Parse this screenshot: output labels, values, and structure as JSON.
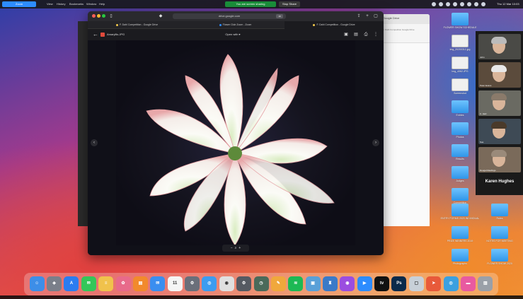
{
  "menubar": {
    "zoom_pill": "Zoom",
    "items": [
      "View",
      "History",
      "Bookmarks",
      "Window",
      "Help"
    ],
    "share_status": "You are screen sharing",
    "stop_share": "Stop Share",
    "clock": "Thu 12 Mar 10:03"
  },
  "browser": {
    "url": "drive.google.com",
    "url_badge": "19",
    "tabs": [
      {
        "label": "F. Dahl Competition - Google Drive",
        "dot_color": "#f2c94c"
      },
      {
        "label": "Flower Club Zoom - Zoom",
        "dot_color": "#2d8cff"
      },
      {
        "label": "F. Dahl Competition - Google Drive",
        "dot_color": "#f2c94c"
      }
    ]
  },
  "viewer": {
    "file_name": "Amaryllis.JPG",
    "open_with": "Open with",
    "zoom_minus": "−",
    "zoom_icon": "⌕",
    "zoom_plus": "+"
  },
  "background_window": {
    "title": "Google Drive",
    "subtitle": "F. Dahl Competition  Google Drive"
  },
  "desktop_icons": [
    {
      "label": "FLOWER SHOW SCHEDULE",
      "kind": "folder"
    },
    {
      "label": "img_20200312.jpg",
      "kind": "doc"
    },
    {
      "label": "img_4062.JPG",
      "kind": "doc"
    },
    {
      "label": "Screenshot",
      "kind": "doc"
    },
    {
      "label": "Entries",
      "kind": "folder"
    },
    {
      "label": "Photos",
      "kind": "folder"
    },
    {
      "label": "Results",
      "kind": "folder"
    },
    {
      "label": "Judges",
      "kind": "folder"
    },
    {
      "label": "Competition",
      "kind": "folder"
    }
  ],
  "desktop_icons_bottom": [
    {
      "label": "ENTRY FORMS 2020 INDIVIDUAL",
      "kind": "folder"
    },
    {
      "label": "Rules",
      "kind": "folder"
    },
    {
      "label": "PRIZE WINNERS 2019",
      "kind": "folder"
    },
    {
      "label": "NOTES FOR MEETING",
      "kind": "folder"
    },
    {
      "label": "Photographs",
      "kind": "folder"
    },
    {
      "label": "FLOWER SHOW 2020",
      "kind": "folder"
    }
  ],
  "zoom_gallery": {
    "tiles": [
      {
        "name": "John",
        "bg": "#4a4a46",
        "hair": "#bbbbbb"
      },
      {
        "name": "Peter Evans",
        "bg": "#5b4b3c",
        "hair": "#e8e8e8"
      },
      {
        "name": "C. Hart",
        "bg": "#6a6a62",
        "hair": "#8a7a6a"
      },
      {
        "name": "Sue",
        "bg": "#3e4a55",
        "hair": "#4a3a2a"
      },
      {
        "name": "Dougal Rawlings",
        "bg": "#7a6a5a",
        "hair": "#9a8a7a"
      }
    ],
    "speaker": "Karen Hughes"
  },
  "dock": {
    "apps": [
      {
        "name": "finder",
        "color": "#3d8ee8",
        "glyph": "☺"
      },
      {
        "name": "launchpad",
        "color": "#7a7f8a",
        "glyph": "◈"
      },
      {
        "name": "app-store",
        "color": "#2b7cf0",
        "glyph": "A"
      },
      {
        "name": "messages",
        "color": "#34c759",
        "glyph": "✉"
      },
      {
        "name": "notes",
        "color": "#f0c24c",
        "glyph": "≡"
      },
      {
        "name": "photos",
        "color": "#e86a8a",
        "glyph": "✿"
      },
      {
        "name": "books",
        "color": "#f28a2c",
        "glyph": "▤"
      },
      {
        "name": "mail",
        "color": "#3a8ef0",
        "glyph": "✉"
      },
      {
        "name": "calendar",
        "color": "#f5f5f5",
        "glyph": "11"
      },
      {
        "name": "system-preferences",
        "color": "#6a6f7a",
        "glyph": "⚙"
      },
      {
        "name": "safari",
        "color": "#3c9cf0",
        "glyph": "◎"
      },
      {
        "name": "chrome",
        "color": "#e0e0e0",
        "glyph": "◉"
      },
      {
        "name": "settings",
        "color": "#555a62",
        "glyph": "⚙"
      },
      {
        "name": "time-machine",
        "color": "#4a6a5a",
        "glyph": "◷"
      },
      {
        "name": "pages",
        "color": "#f0a83c",
        "glyph": "✎"
      },
      {
        "name": "spotify",
        "color": "#1db954",
        "glyph": "≋"
      },
      {
        "name": "preview",
        "color": "#5aa0d8",
        "glyph": "▣"
      },
      {
        "name": "keynote",
        "color": "#3a7ac8",
        "glyph": "♜"
      },
      {
        "name": "podcasts",
        "color": "#9b4de0",
        "glyph": "◉"
      },
      {
        "name": "zoom",
        "color": "#2d8cff",
        "glyph": "▶"
      },
      {
        "name": "apple-tv",
        "color": "#111111",
        "glyph": "tv"
      },
      {
        "name": "photoshop",
        "color": "#0a2a4a",
        "glyph": "Ps"
      },
      {
        "name": "folder",
        "color": "#c8d0d8",
        "glyph": "▢"
      },
      {
        "name": "airmail",
        "color": "#e85a3a",
        "glyph": "➤"
      },
      {
        "name": "safari-2",
        "color": "#3ca0e0",
        "glyph": "◎"
      },
      {
        "name": "reminders",
        "color": "#e85aa0",
        "glyph": "▬"
      },
      {
        "name": "trash",
        "color": "#9aa0a8",
        "glyph": "▥"
      }
    ]
  }
}
